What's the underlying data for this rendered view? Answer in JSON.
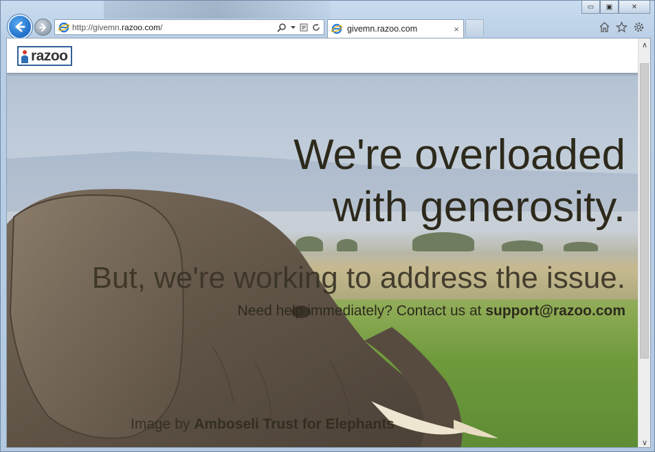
{
  "browser": {
    "address": {
      "url_prefix": "http://givemn.",
      "url_domain": "razoo.com",
      "url_suffix": "/"
    },
    "tab": {
      "title": "givemn.razoo.com",
      "close_glyph": "×"
    },
    "window_controls": {
      "minimize": "▭",
      "maximize": "▣",
      "close": "✕"
    },
    "icons": [
      "back-arrow-icon",
      "forward-arrow-icon",
      "ie-icon",
      "search-icon",
      "compat-view-icon",
      "refresh-icon",
      "home-icon",
      "favorites-star-icon",
      "settings-gear-icon"
    ]
  },
  "site": {
    "logo_text": "razoo",
    "headline_line1": "We're overloaded",
    "headline_line2": "with generosity.",
    "subhead": "But, we're working to address the issue.",
    "contact_text": "Need help immediately? Contact us at ",
    "contact_email": "support@razoo.com",
    "credit_text": "Image by ",
    "credit_source": "Amboseli Trust for Elephants"
  },
  "scrollbar": {
    "up_glyph": "∧",
    "down_glyph": "∨"
  },
  "colors": {
    "accent_blue": "#1f6fc9",
    "headline": "#2d2a1c",
    "logo_border": "#2f5f9a"
  }
}
